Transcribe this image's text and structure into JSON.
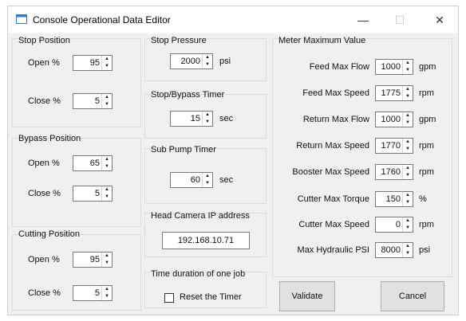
{
  "window": {
    "title": "Console Operational Data Editor",
    "minimize": "—",
    "maximize": "☐",
    "close": "✕"
  },
  "stop_position": {
    "title": "Stop Position",
    "open_label": "Open %",
    "open_value": "95",
    "close_label": "Close %",
    "close_value": "5"
  },
  "bypass_position": {
    "title": "Bypass Position",
    "open_label": "Open %",
    "open_value": "65",
    "close_label": "Close %",
    "close_value": "5"
  },
  "cutting_position": {
    "title": "Cutting Position",
    "open_label": "Open %",
    "open_value": "95",
    "close_label": "Close %",
    "close_value": "5"
  },
  "stop_pressure": {
    "title": "Stop Pressure",
    "value": "2000",
    "unit": "psi"
  },
  "stop_bypass_timer": {
    "title": "Stop/Bypass Timer",
    "value": "15",
    "unit": "sec"
  },
  "sub_pump_timer": {
    "title": "Sub Pump Timer",
    "value": "60",
    "unit": "sec"
  },
  "head_camera": {
    "title": "Head Camera IP address",
    "value": "192.168.10.71"
  },
  "job_duration": {
    "title": "Time duration of one job",
    "checkbox_label": "Reset the Timer"
  },
  "meter": {
    "title": "Meter Maximum Value",
    "rows": [
      {
        "label": "Feed Max Flow",
        "value": "1000",
        "unit": "gpm"
      },
      {
        "label": "Feed Max Speed",
        "value": "1775",
        "unit": "rpm"
      },
      {
        "label": "Return Max Flow",
        "value": "1000",
        "unit": "gpm"
      },
      {
        "label": "Return Max Speed",
        "value": "1770",
        "unit": "rpm"
      },
      {
        "label": "Booster Max Speed",
        "value": "1760",
        "unit": "rpm"
      },
      {
        "label": "Cutter Max Torque",
        "value": "150",
        "unit": "%"
      },
      {
        "label": "Cutter Max Speed",
        "value": "0",
        "unit": "rpm"
      },
      {
        "label": "Max Hydraulic PSI",
        "value": "8000",
        "unit": "psi"
      }
    ]
  },
  "buttons": {
    "validate": "Validate",
    "cancel": "Cancel"
  }
}
